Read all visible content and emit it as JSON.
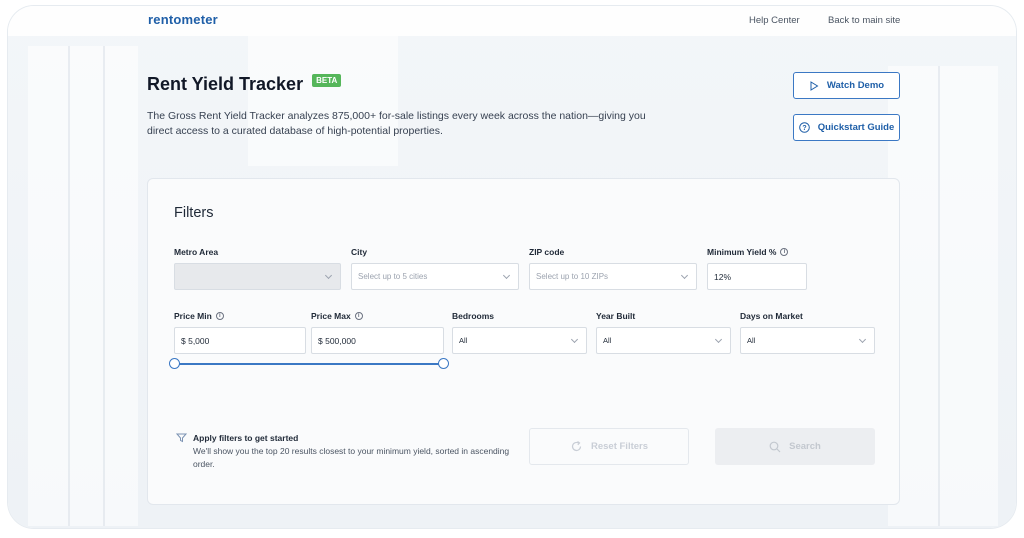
{
  "header": {
    "logo": "rentometer",
    "nav": [
      "Help Center",
      "Back to main site"
    ]
  },
  "hero": {
    "title": "Rent Yield Tracker",
    "badge": "BETA",
    "description": "The Gross Rent Yield Tracker analyzes 875,000+ for-sale listings every week across the nation—giving you direct access to a curated database of high-potential properties.",
    "watch_demo": "Watch Demo",
    "quickstart": "Quickstart Guide"
  },
  "filters": {
    "title": "Filters",
    "metro": {
      "label": "Metro Area",
      "value": ""
    },
    "city": {
      "label": "City",
      "placeholder": "Select up to 5 cities"
    },
    "zip": {
      "label": "ZIP code",
      "placeholder": "Select up to 10 ZIPs"
    },
    "min_yield": {
      "label": "Minimum Yield %",
      "value": "12%"
    },
    "price_min": {
      "label": "Price Min",
      "value": "$ 5,000"
    },
    "price_max": {
      "label": "Price Max",
      "value": "$ 500,000"
    },
    "bedrooms": {
      "label": "Bedrooms",
      "value": "All"
    },
    "year_built": {
      "label": "Year Built",
      "value": "All"
    },
    "days_on_market": {
      "label": "Days on Market",
      "value": "All"
    },
    "hint_title": "Apply filters to get started",
    "hint_text": "We'll show you the top 20 results closest to your minimum yield, sorted in ascending order.",
    "reset_label": "Reset Filters",
    "search_label": "Search"
  },
  "colors": {
    "brand": "#1f5fa8",
    "accent": "#3b78c4",
    "beta_badge": "#55b65a"
  }
}
